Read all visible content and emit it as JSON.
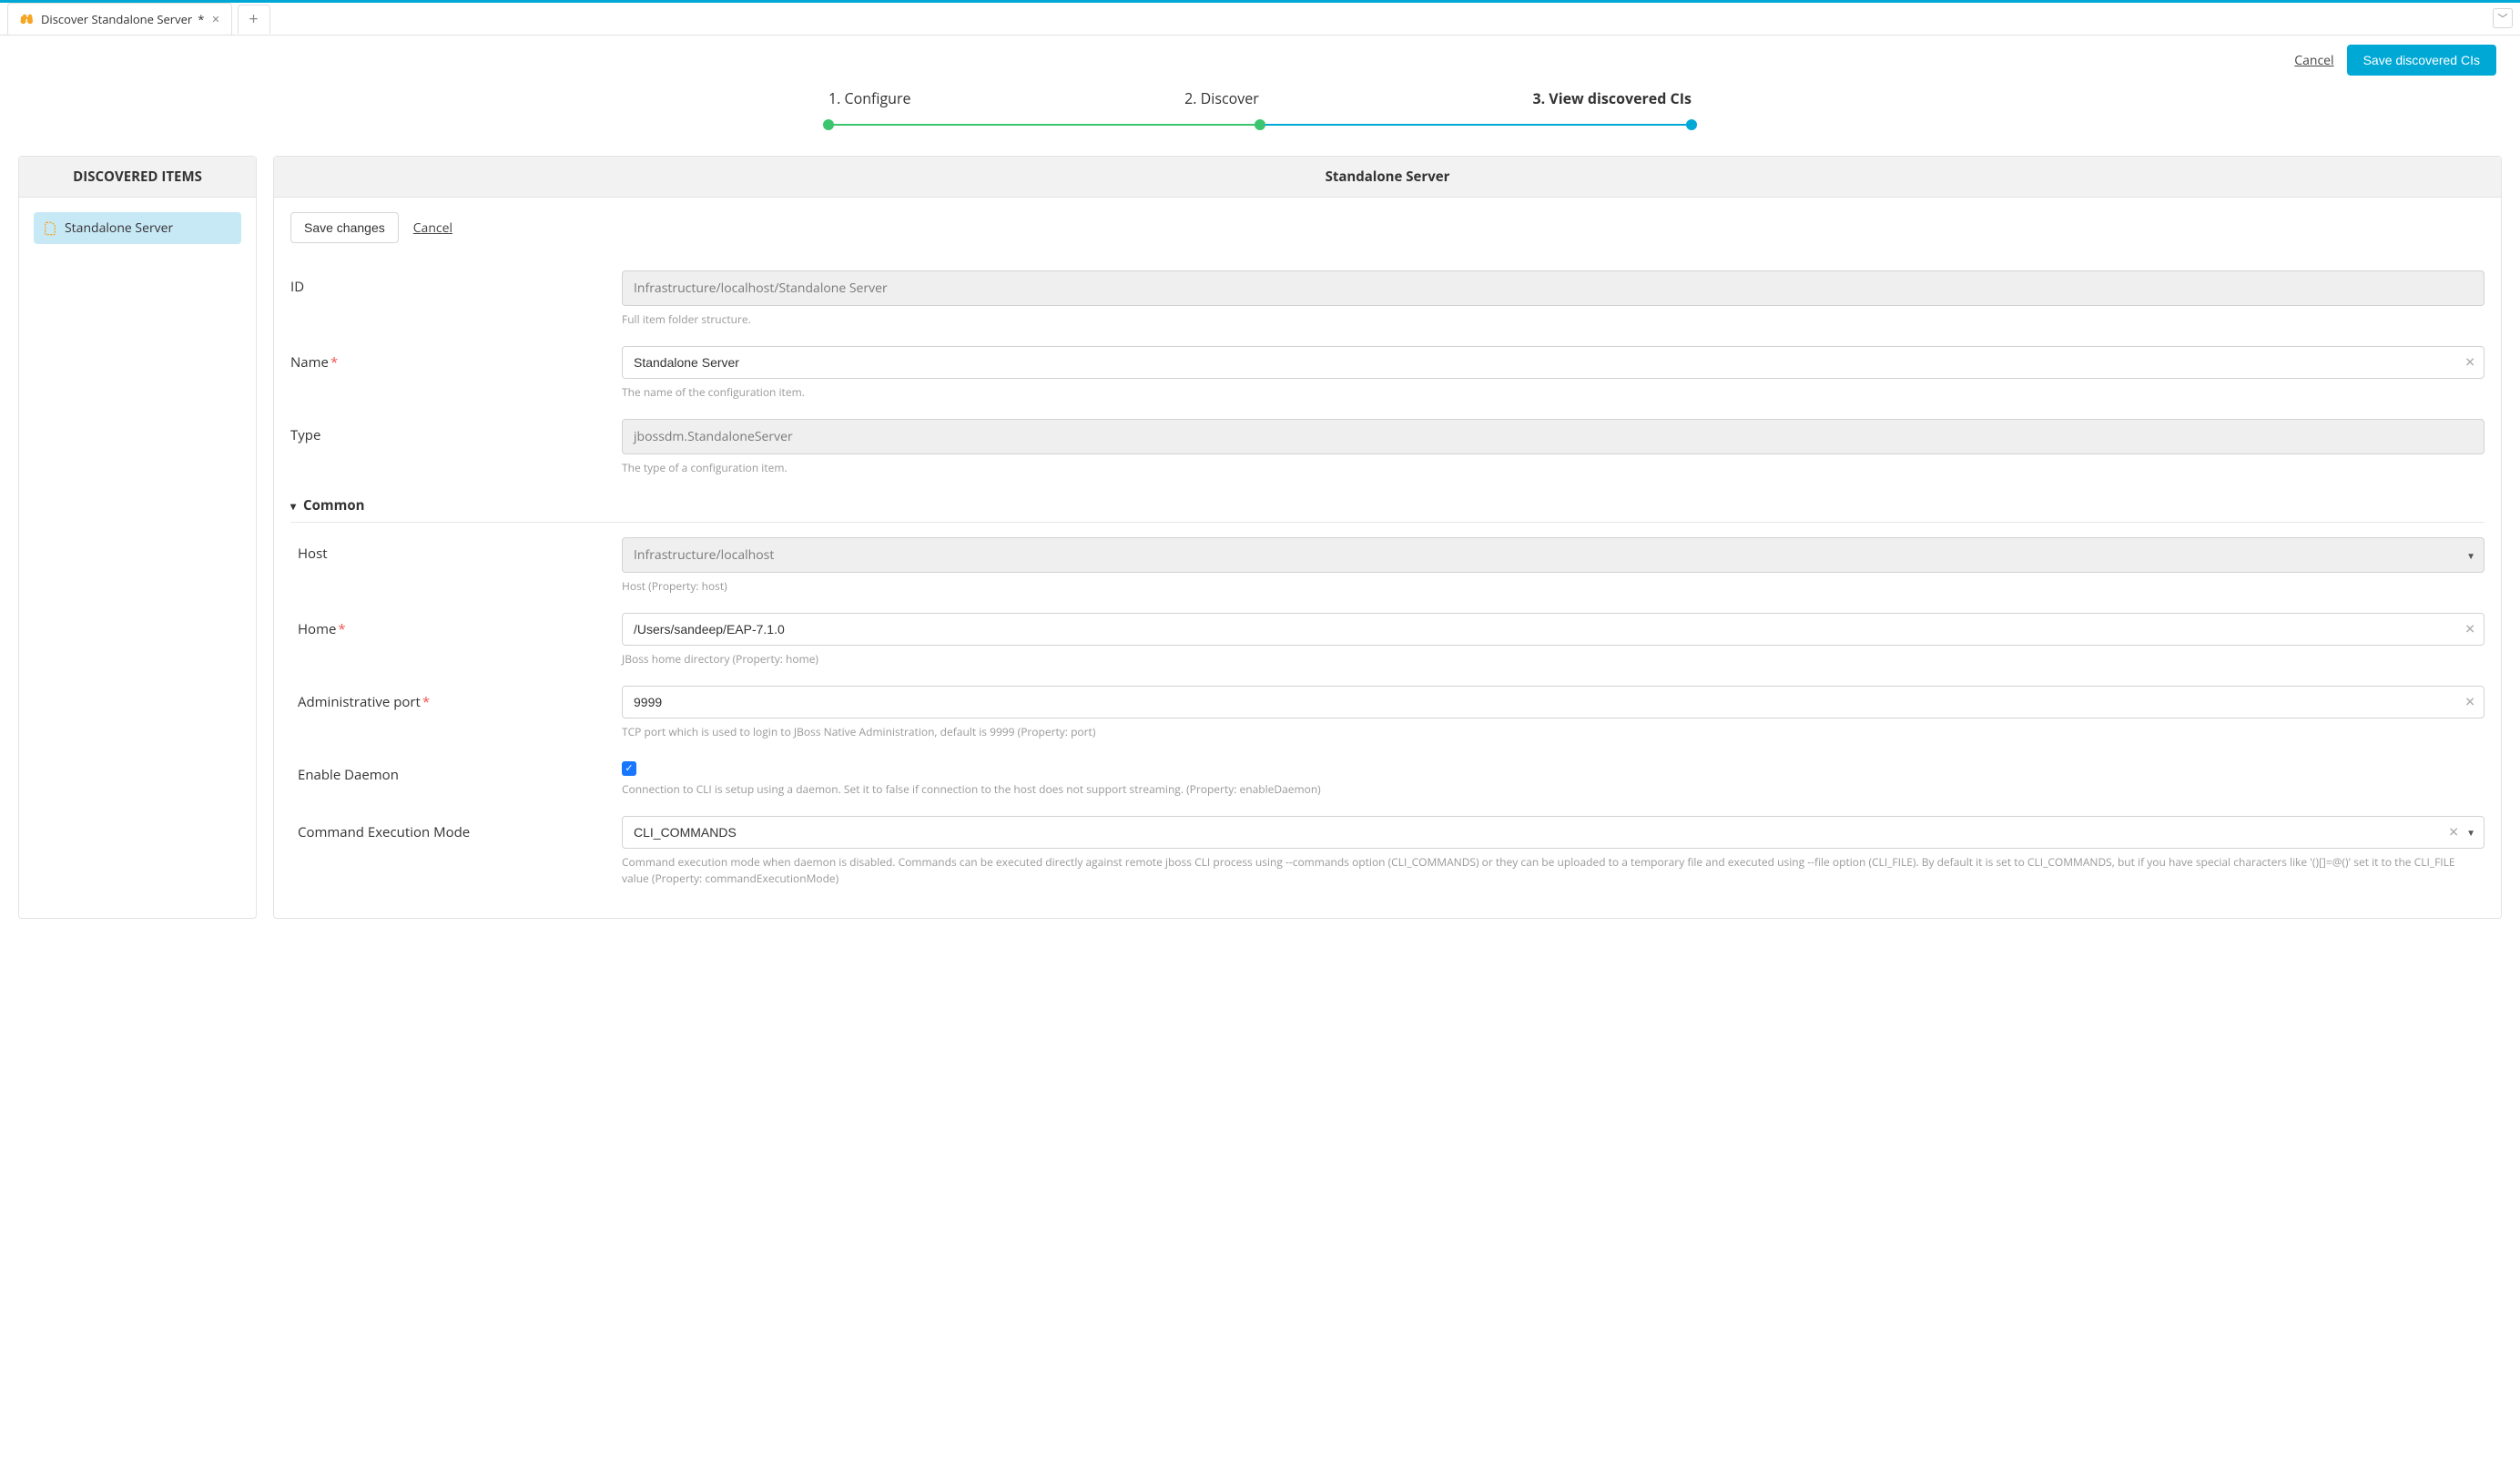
{
  "tab": {
    "title": "Discover Standalone Server",
    "modified_marker": "*"
  },
  "top_actions": {
    "cancel": "Cancel",
    "save_discovered": "Save discovered CIs"
  },
  "stepper": {
    "step1": "1. Configure",
    "step2": "2. Discover",
    "step3": "3. View discovered CIs"
  },
  "left_panel": {
    "title": "DISCOVERED ITEMS",
    "items": [
      {
        "label": "Standalone Server"
      }
    ]
  },
  "right_panel": {
    "title": "Standalone Server",
    "inner_actions": {
      "save": "Save changes",
      "cancel": "Cancel"
    }
  },
  "form": {
    "id": {
      "label": "ID",
      "value": "Infrastructure/localhost/Standalone Server",
      "helper": "Full item folder structure."
    },
    "name": {
      "label": "Name",
      "value": "Standalone Server",
      "helper": "The name of the configuration item."
    },
    "type": {
      "label": "Type",
      "value": "jbossdm.StandaloneServer",
      "helper": "The type of a configuration item."
    },
    "section_common": "Common",
    "host": {
      "label": "Host",
      "value": "Infrastructure/localhost",
      "helper": "Host (Property: host)"
    },
    "home": {
      "label": "Home",
      "value": "/Users/sandeep/EAP-7.1.0",
      "helper": "JBoss home directory (Property: home)"
    },
    "admin_port": {
      "label": "Administrative port",
      "value": "9999",
      "helper": "TCP port which is used to login to JBoss Native Administration, default is 9999 (Property: port)"
    },
    "enable_daemon": {
      "label": "Enable Daemon",
      "checked": true,
      "helper": "Connection to CLI is setup using a daemon. Set it to false if connection to the host does not support streaming. (Property: enableDaemon)"
    },
    "cmd_mode": {
      "label": "Command Execution Mode",
      "value": "CLI_COMMANDS",
      "helper": "Command execution mode when daemon is disabled. Commands can be executed directly against remote jboss CLI process using --commands option (CLI_COMMANDS) or they can be uploaded to a temporary file and executed using --file option (CLI_FILE). By default it is set to CLI_COMMANDS, but if you have special characters like '()[]=@()' set it to the CLI_FILE value (Property: commandExecutionMode)"
    }
  }
}
